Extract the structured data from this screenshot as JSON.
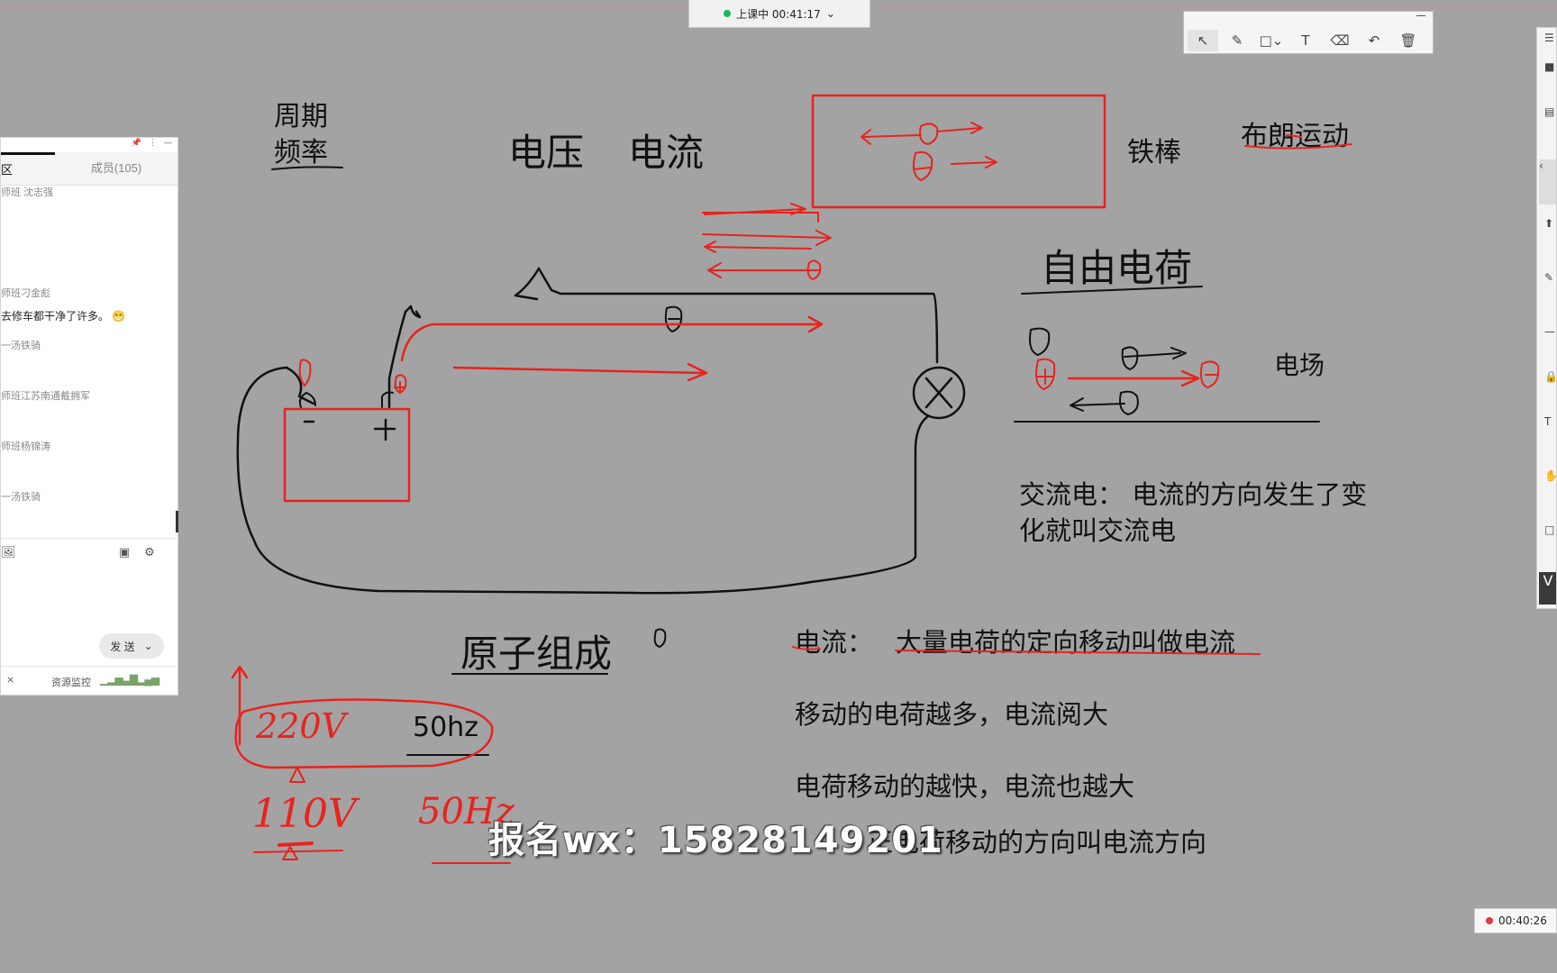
{
  "status_bar": {
    "label": "上课中 00:41:17"
  },
  "draw_tools": [
    "select-icon",
    "pen-icon",
    "shape-icon",
    "text-icon",
    "eraser-icon",
    "undo-icon",
    "delete-icon"
  ],
  "chat": {
    "tab_active": "区",
    "tab_members": "成员(105)",
    "messages": [
      {
        "name": "师班 沈志强",
        "text": ""
      },
      {
        "name": "师班刁金彪",
        "text": "去修车都干净了许多。"
      },
      {
        "name": "一汤铁骑",
        "text": ""
      },
      {
        "name": "师班江苏南通戴拥军",
        "text": ""
      },
      {
        "name": "师班杨锦涛",
        "text": ""
      },
      {
        "name": "一汤铁骑",
        "text": ""
      }
    ],
    "send": "发 送",
    "monitor": "资源监控"
  },
  "board": {
    "zhouqi": "周期",
    "pinlv": "频率",
    "dianya": "电压",
    "dianliu": "电流",
    "tiebang": "铁棒",
    "bulang": "布朗运动",
    "ziyou": "自由电荷",
    "dianchang": "电场",
    "jiaoliu_1": "交流电：  电流的方向发生了变",
    "jiaoliu_2": "化就叫交流电",
    "yuanzi": "原子组成",
    "dl_label": "电流：",
    "dl_def": "大量电荷的定向移动叫做电流",
    "line2": "移动的电荷越多，电流阅大",
    "line3": "电荷移动的越快，电流也越大",
    "line4": "正电荷移动的方向叫电流方向",
    "hz50": "50hz"
  },
  "ink": {
    "v220": "220V",
    "v110": "110V",
    "hz": "50Hz"
  },
  "watermark": "报名wx：15828149201",
  "timer": "00:40:26",
  "colors": {
    "ink_red": "#e8231e",
    "ink_black": "#111111",
    "board_bg": "#a3a3a3"
  }
}
